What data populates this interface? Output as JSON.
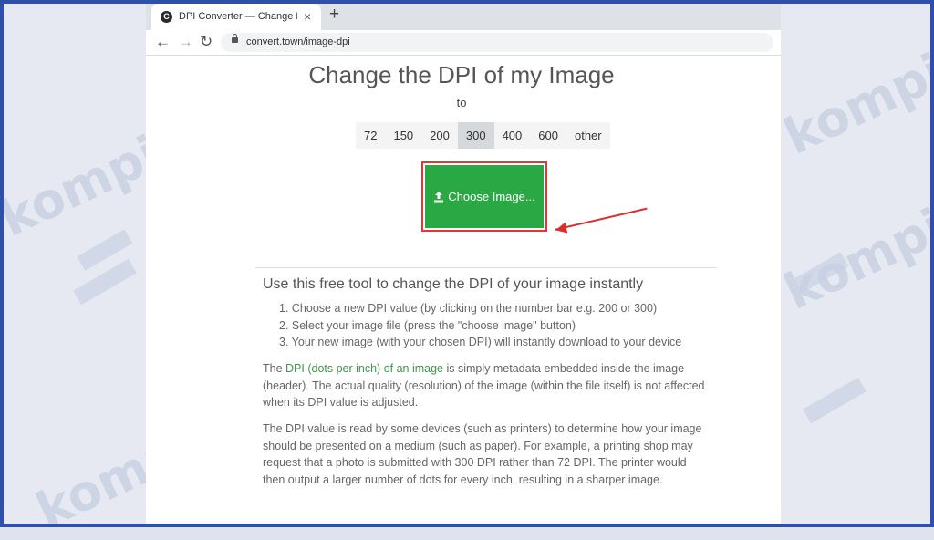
{
  "watermark": {
    "text": "kompiwin"
  },
  "browser": {
    "tab": {
      "title": "DPI Converter — Change DPI of",
      "favicon": "C",
      "close": "×"
    },
    "new_tab": "+",
    "nav": {
      "back": "←",
      "forward": "→",
      "reload": "↻"
    },
    "url": "convert.town/image-dpi"
  },
  "page": {
    "title": "Change the DPI of my Image",
    "to_label": "to",
    "dpi_options": [
      {
        "label": "72"
      },
      {
        "label": "150"
      },
      {
        "label": "200"
      },
      {
        "label": "300",
        "active": true
      },
      {
        "label": "400"
      },
      {
        "label": "600"
      },
      {
        "label": "other"
      }
    ],
    "choose_button": "Choose Image...",
    "section_heading": "Use this free tool to change the DPI of your image instantly",
    "steps": [
      "1. Choose a new DPI value (by clicking on the number bar e.g. 200 or 300)",
      "2. Select your image file (press the \"choose image\" button)",
      "3. Your new image (with your chosen DPI) will instantly download to your device"
    ],
    "para1_prefix": "The ",
    "para1_link": "DPI (dots per inch) of an image",
    "para1_rest": " is simply metadata embedded inside the image (header). The actual quality (resolution) of the image (within the file itself) is not affected when its DPI value is adjusted.",
    "para2": "The DPI value is read by some devices (such as printers) to determine how your image should be presented on a medium (such as paper). For example, a printing shop may request that a photo is submitted with 300 DPI rather than 72 DPI. The printer would then output a larger number of dots for every inch, resulting in a sharper image."
  },
  "colors": {
    "accent_green": "#2aa844",
    "highlight_red": "#e13737",
    "link_green": "#3a9a46",
    "frame_blue": "#2f4fa8"
  }
}
